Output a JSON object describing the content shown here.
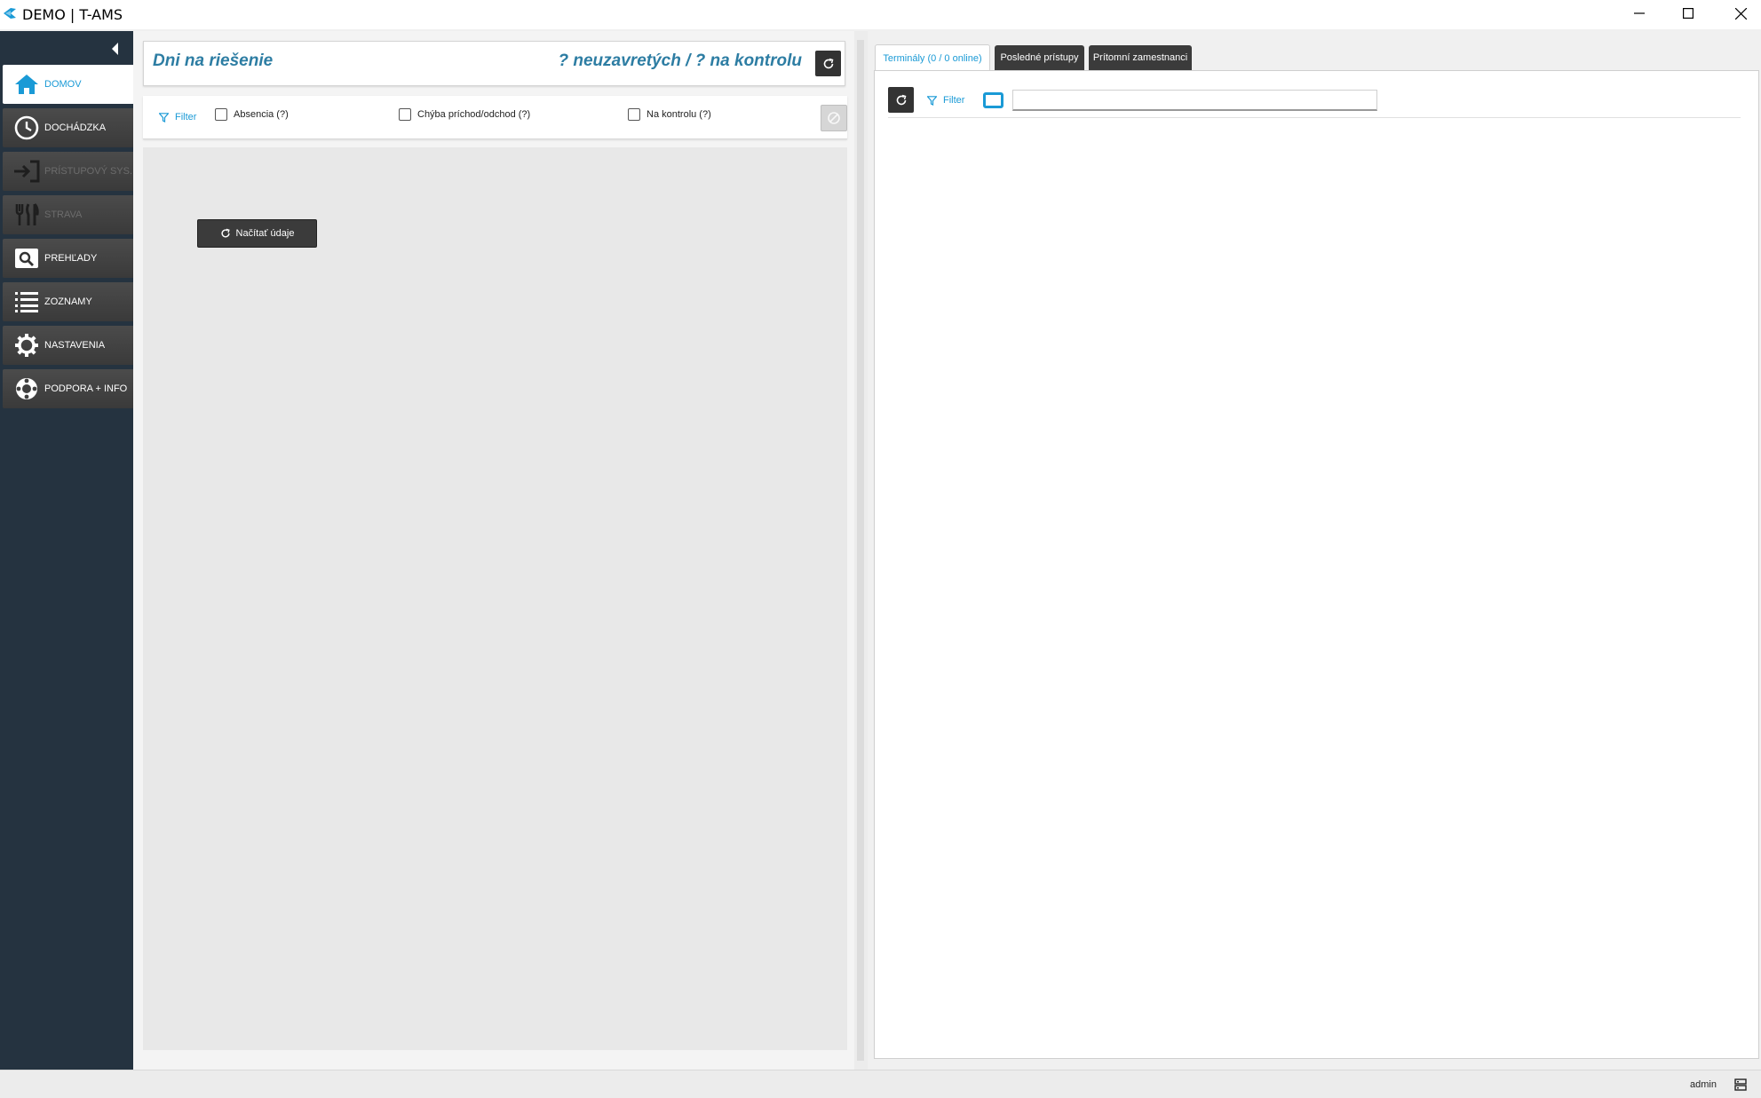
{
  "window": {
    "title": "DEMO | T-AMS",
    "minimize_icon": "minimize-icon",
    "maximize_icon": "maximize-icon",
    "close_icon": "close-icon"
  },
  "sidebar": {
    "items": [
      {
        "label": "DOMOV",
        "icon": "home-icon",
        "state": "active"
      },
      {
        "label": "DOCHÁDZKA",
        "icon": "clock-icon",
        "state": "enabled"
      },
      {
        "label": "PRÍSTUPOVÝ SYS.",
        "icon": "login-icon",
        "state": "disabled"
      },
      {
        "label": "STRAVA",
        "icon": "utensils-icon",
        "state": "disabled"
      },
      {
        "label": "PREHĽADY",
        "icon": "search-icon",
        "state": "enabled"
      },
      {
        "label": "ZOZNAMY",
        "icon": "list-icon",
        "state": "enabled"
      },
      {
        "label": "NASTAVENIA",
        "icon": "gear-icon",
        "state": "enabled"
      },
      {
        "label": "PODPORA + INFO",
        "icon": "lifebuoy-icon",
        "state": "enabled"
      }
    ]
  },
  "left_panel": {
    "title": "Dni na riešenie",
    "summary": "? neuzavretých / ? na kontrolu",
    "filter_label": "Filter",
    "checkboxes": [
      {
        "label": "Absencia (?)",
        "checked": false
      },
      {
        "label": "Chýba príchod/odchod (?)",
        "checked": false
      },
      {
        "label": "Na kontrolu (?)",
        "checked": false
      }
    ],
    "load_button": "Načítať údaje"
  },
  "right_panel": {
    "tabs": [
      {
        "label": "Terminály (0 / 0 online)",
        "active": true
      },
      {
        "label": "Posledné prístupy",
        "active": false
      },
      {
        "label": "Prítomní zamestnanci",
        "active": false
      }
    ],
    "filter_label": "Filter",
    "search_value": ""
  },
  "statusbar": {
    "user": "admin"
  },
  "colors": {
    "accent": "#1a9ad6",
    "title_blue": "#2d7da3",
    "sidebar_bg": "#253340"
  }
}
